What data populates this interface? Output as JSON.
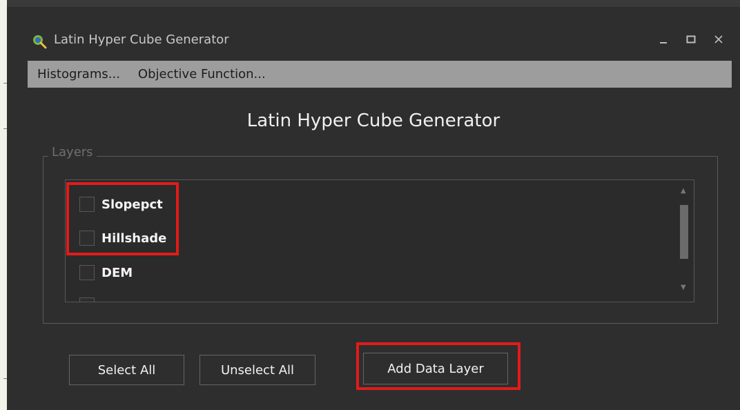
{
  "window": {
    "title": "Latin Hyper Cube Generator",
    "controls": {
      "minimize": "_",
      "maximize": "☐",
      "close": "✕"
    }
  },
  "menu": {
    "items": [
      {
        "label": "Histograms..."
      },
      {
        "label": "Objective Function..."
      }
    ]
  },
  "main": {
    "heading": "Latin Hyper Cube Generator",
    "layers_group_label": "Layers",
    "layers": [
      {
        "label": "Slopepct",
        "checked": false
      },
      {
        "label": "Hillshade",
        "checked": false
      },
      {
        "label": "DEM",
        "checked": false
      },
      {
        "label": "",
        "checked": false
      }
    ]
  },
  "buttons": {
    "select_all": "Select All",
    "unselect_all": "Unselect All",
    "add_data_layer": "Add Data Layer"
  },
  "colors": {
    "window_bg": "#2e2e2e",
    "menubar_bg": "#9d9d9d",
    "highlight": "#e31b1b"
  },
  "icons": {
    "app": "qgis-app-icon"
  }
}
